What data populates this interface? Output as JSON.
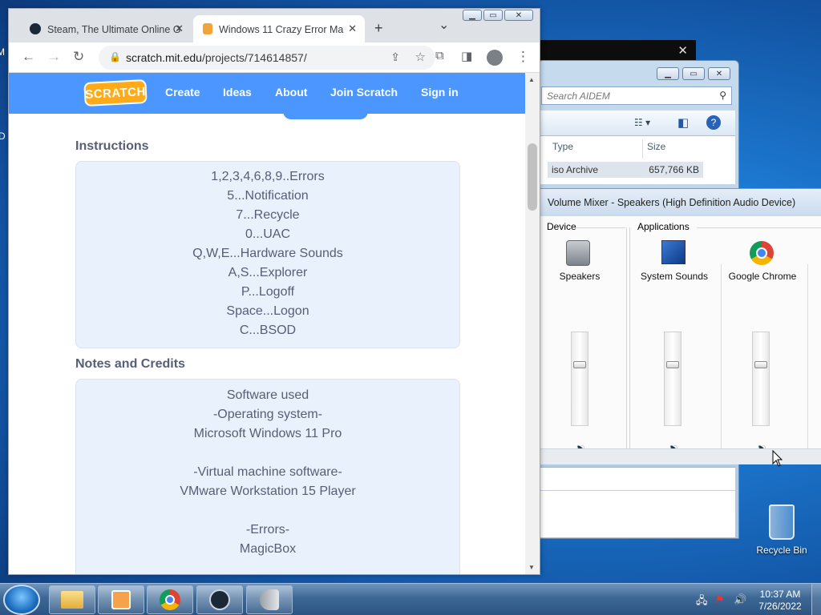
{
  "desktop": {
    "peek_left_top": "M",
    "peek_left_mid": "D",
    "recycle_bin_label": "Recycle Bin"
  },
  "background_window": {
    "close_glyph": "✕"
  },
  "explorer": {
    "search_placeholder": "Search AIDEM",
    "columns": [
      "Type",
      "Size"
    ],
    "row": {
      "type": "iso Archive",
      "size": "657,766 KB"
    }
  },
  "mixer": {
    "title": "Volume Mixer - Speakers (High Definition Audio Device)",
    "device_group": "Device",
    "applications_group": "Applications",
    "channels": [
      {
        "name": "Speakers",
        "icon": "speakers-icon",
        "level": 0.67
      },
      {
        "name": "System Sounds",
        "icon": "system-sounds-icon",
        "level": 0.67
      },
      {
        "name": "Google Chrome",
        "icon": "chrome-icon",
        "level": 0.67
      }
    ]
  },
  "browser": {
    "tabs": [
      {
        "label": "Steam, The Ultimate Online G",
        "icon": "steam-icon",
        "active": false
      },
      {
        "label": "Windows 11 Crazy Error Ma",
        "icon": "scratch-icon",
        "active": true
      }
    ],
    "url_host": "scratch.mit.edu",
    "url_path": "/projects/714614857/",
    "new_tab_glyph": "+",
    "tab_search_glyph": "⌄"
  },
  "scratch": {
    "logo": "SCRATCH",
    "nav": [
      "Create",
      "Ideas",
      "About",
      "Join Scratch",
      "Sign in"
    ],
    "instructions_heading": "Instructions",
    "instructions": [
      "1,2,3,4,6,8,9..Errors",
      "5...Notification",
      "7...Recycle",
      "0...UAC",
      "Q,W,E...Hardware Sounds",
      "A,S...Explorer",
      "P...Logoff",
      "Space...Logon",
      "C...BSOD"
    ],
    "notes_heading": "Notes and Credits",
    "notes": [
      "Software used",
      "-Operating system-",
      "Microsoft Windows 11 Pro",
      "",
      "-Virtual machine software-",
      "VMware Workstation 15 Player",
      "",
      "-Errors-",
      "MagicBox"
    ]
  },
  "taskbar": {
    "time": "10:37 AM",
    "date": "7/26/2022",
    "buttons": [
      "explorer-icon",
      "media-player-icon",
      "chrome-icon",
      "steam-icon",
      "volume-mixer-icon"
    ]
  }
}
